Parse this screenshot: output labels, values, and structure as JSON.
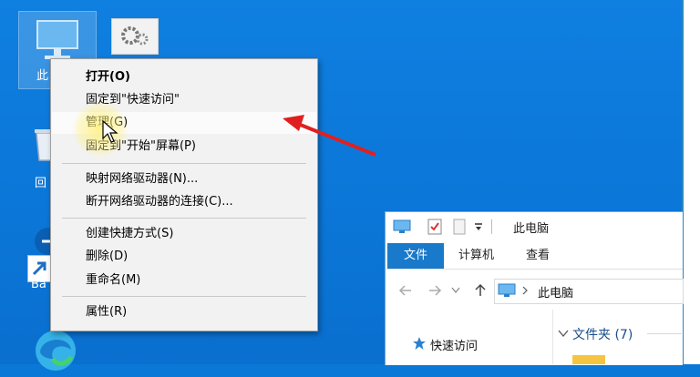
{
  "desktop": {
    "this_pc_label": "此",
    "recycle_label": "回",
    "ban_label": "Ba"
  },
  "context_menu": {
    "items": [
      {
        "label": "打开(O)",
        "bold": true
      },
      {
        "label": "固定到\"快速访问\""
      },
      {
        "label": "管理(G)",
        "hover": true
      },
      {
        "label": "固定到\"开始\"屏幕(P)"
      },
      {
        "label": "映射网络驱动器(N)..."
      },
      {
        "label": "断开网络驱动器的连接(C)..."
      },
      {
        "label": "创建快捷方式(S)"
      },
      {
        "label": "删除(D)"
      },
      {
        "label": "重命名(M)"
      },
      {
        "label": "属性(R)"
      }
    ]
  },
  "explorer": {
    "title": "此电脑",
    "ribbon": {
      "file": "文件",
      "computer": "计算机",
      "view": "查看"
    },
    "address": "此电脑",
    "quick_access": "快速访问",
    "folders_header": "文件夹 (7)"
  },
  "colors": {
    "desktop_blue": "#0b77d8",
    "menu_bg": "#f2f2f2",
    "ribbon_file_blue": "#1979ca",
    "arrow_red": "#e02020"
  }
}
